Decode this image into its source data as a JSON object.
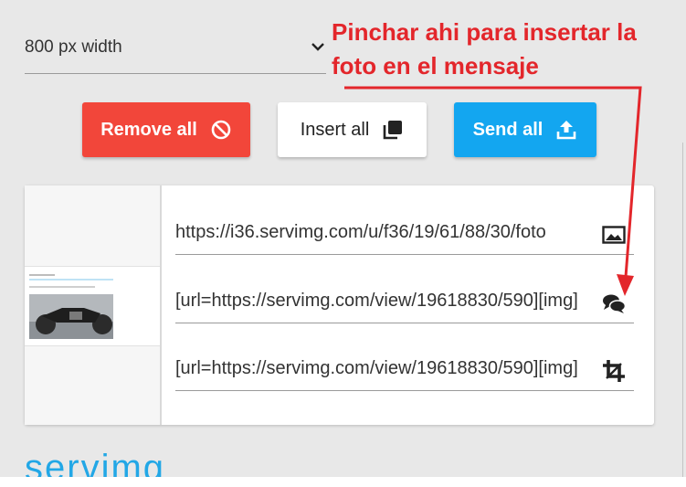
{
  "format_select": {
    "value": "800 px width"
  },
  "annotation": {
    "line1": "Pinchar ahi para insertar la",
    "line2": "foto en el mensaje",
    "color": "#e3262b"
  },
  "buttons": {
    "remove_all": "Remove all",
    "insert_all": "Insert all",
    "send_all": "Send all"
  },
  "colors": {
    "remove": "#f2463a",
    "send": "#13a6f0",
    "brand": "#22a7e6"
  },
  "result_rows": [
    {
      "text": "https://i36.servimg.com/u/f36/19/61/88/30/foto",
      "icon": "image-icon"
    },
    {
      "text": "[url=https://servimg.com/view/19618830/590][img]",
      "icon": "chat-bubbles-icon"
    },
    {
      "text": "[url=https://servimg.com/view/19618830/590][img]",
      "icon": "crop-icon"
    }
  ],
  "logo": {
    "text": "servimg"
  }
}
